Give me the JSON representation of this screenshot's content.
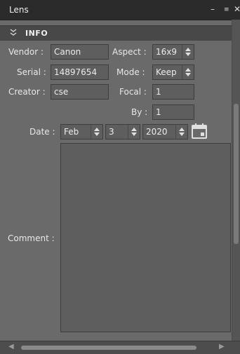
{
  "window": {
    "title": "Lens",
    "minimize_glyph": "–",
    "menu_glyph": "≡",
    "close_glyph": "✕"
  },
  "section": {
    "title": "INFO",
    "icon": "double-chevron-down-icon"
  },
  "labels": {
    "vendor": "Vendor :",
    "serial": "Serial :",
    "creator": "Creator :",
    "aspect": "Aspect :",
    "mode": "Mode :",
    "focal": "Focal :",
    "by": "By :",
    "date": "Date :",
    "comment": "Comment :"
  },
  "fields": {
    "vendor": "Canon",
    "serial": "14897654",
    "creator": "cse",
    "aspect": "16x9",
    "mode": "Keep",
    "focal": "1",
    "by": "1",
    "date_month": "Feb",
    "date_day": "3",
    "date_year": "2020",
    "comment": ""
  },
  "icons": {
    "calendar": "calendar-icon",
    "spin": "up-down-arrows-icon"
  }
}
